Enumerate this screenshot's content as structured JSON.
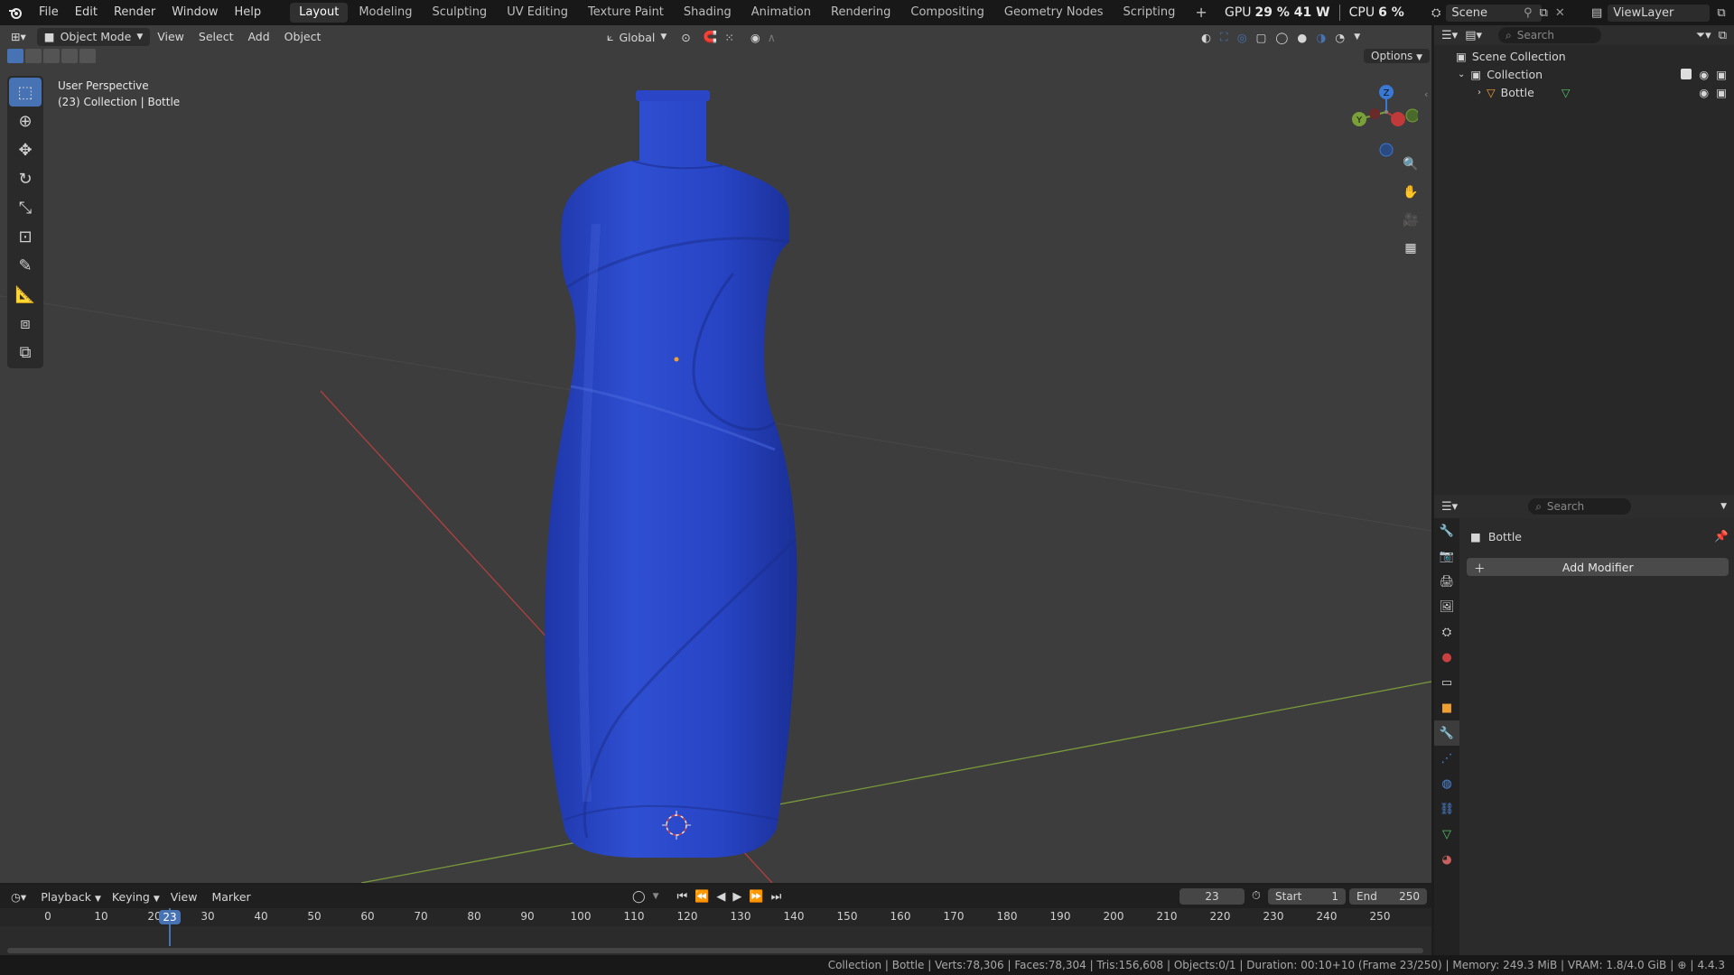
{
  "app": {
    "name": "Blender",
    "version": "4.4.3"
  },
  "menu": [
    "File",
    "Edit",
    "Render",
    "Window",
    "Help"
  ],
  "workspaces": [
    "Layout",
    "Modeling",
    "Sculpting",
    "UV Editing",
    "Texture Paint",
    "Shading",
    "Animation",
    "Rendering",
    "Compositing",
    "Geometry Nodes",
    "Scripting"
  ],
  "active_workspace": "Layout",
  "perf": {
    "gpu_label": "GPU",
    "gpu_value": "29 % 41 W",
    "cpu_label": "CPU",
    "cpu_value": "6 %"
  },
  "scene": {
    "name": "Scene",
    "view_layer": "ViewLayer"
  },
  "viewport": {
    "mode": "Object Mode",
    "menus": [
      "View",
      "Select",
      "Add",
      "Object"
    ],
    "orientation": "Global",
    "options_label": "Options",
    "overlay_title": "User Perspective",
    "overlay_subtitle": "(23) Collection | Bottle"
  },
  "outliner": {
    "search_placeholder": "Search",
    "scene_collection": "Scene Collection",
    "collection": "Collection",
    "object": "Bottle"
  },
  "properties": {
    "search_placeholder": "Search",
    "object_name": "Bottle",
    "add_modifier": "Add Modifier"
  },
  "timeline": {
    "menus": [
      "Playback",
      "Keying",
      "View",
      "Marker"
    ],
    "current_frame": "23",
    "start_label": "Start",
    "start": "1",
    "end_label": "End",
    "end": "250",
    "ticks": [
      "0",
      "10",
      "20",
      "30",
      "40",
      "50",
      "60",
      "70",
      "80",
      "90",
      "100",
      "110",
      "120",
      "130",
      "140",
      "150",
      "160",
      "170",
      "180",
      "190",
      "200",
      "210",
      "220",
      "230",
      "240",
      "250"
    ]
  },
  "statusbar": {
    "text": "Collection | Bottle | Verts:78,306 | Faces:78,304 | Tris:156,608 | Objects:0/1 | Duration: 00:10+10 (Frame 23/250) | Memory: 249.3 MiB | VRAM: 1.8/4.0 GiB",
    "version": "4.4.3"
  },
  "colors": {
    "accent": "#4772b3",
    "bottle": "#2a46c4",
    "x_axis": "#c03a3a",
    "y_axis": "#7aa03a",
    "z_axis": "#3a78d6",
    "origin": "#f0a030"
  }
}
